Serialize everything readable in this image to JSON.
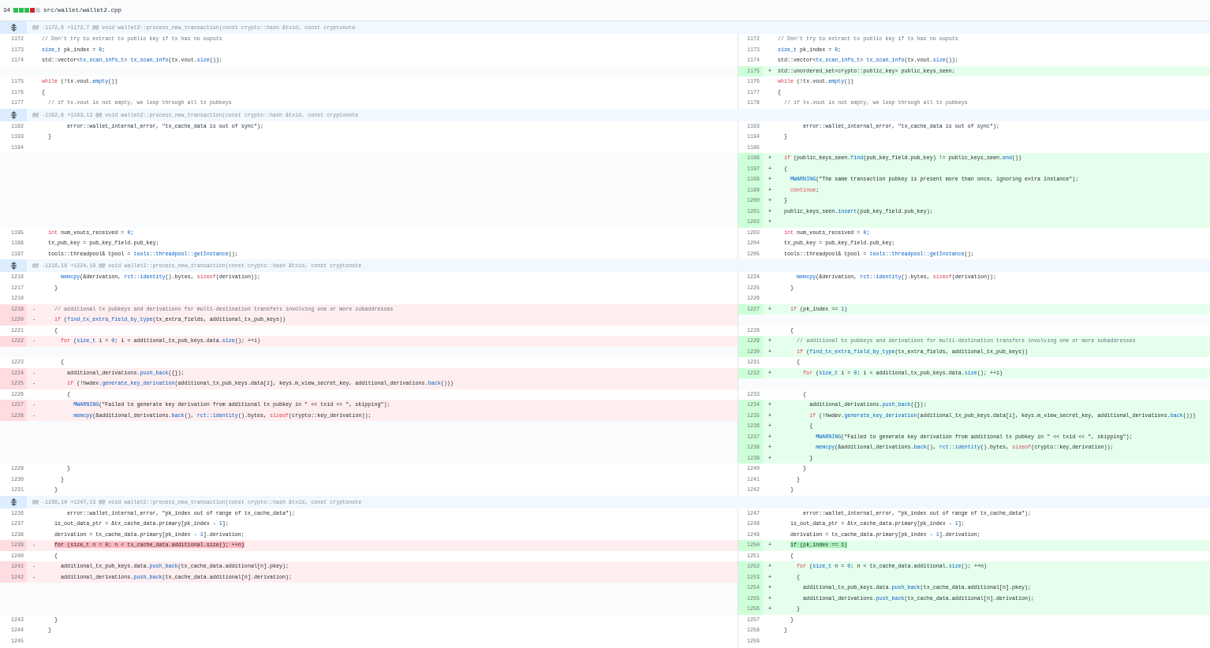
{
  "file_header": {
    "count": "34",
    "diffstat": [
      {
        "kind": "add"
      },
      {
        "kind": "add"
      },
      {
        "kind": "add"
      },
      {
        "kind": "del"
      },
      {
        "kind": "neutral"
      }
    ],
    "path": "src/wallet/wallet2.cpp"
  },
  "rows": [
    {
      "kind": "hunk",
      "text": "@@ -1172,6 +1172,7 @@ void wallet2::process_new_transaction(const crypto::hash &txid, const cryptonote"
    },
    {
      "kind": "line",
      "left": {
        "num": "1172",
        "kind": "context",
        "code": [
          {
            "text": "// Don't try to extract tx public key if tx has no ouputs",
            "kind": "comment"
          }
        ]
      },
      "right": {
        "num": "1172",
        "kind": "context",
        "code": [
          {
            "text": "// Don't try to extract tx public key if tx has no ouputs",
            "kind": "comment"
          }
        ]
      }
    },
    {
      "kind": "line",
      "left": {
        "num": "1173",
        "kind": "context",
        "code": [
          {
            "text": "size_t",
            "kind": "name"
          },
          {
            "text": " pk_index = "
          },
          {
            "text": "0",
            "kind": "name"
          },
          {
            "text": ";"
          }
        ]
      },
      "right": {
        "num": "1173",
        "kind": "context",
        "code": [
          {
            "text": "size_t",
            "kind": "name"
          },
          {
            "text": " pk_index = "
          },
          {
            "text": "0",
            "kind": "name"
          },
          {
            "text": ";"
          }
        ]
      }
    },
    {
      "kind": "line",
      "left": {
        "num": "1174",
        "kind": "context",
        "code": [
          {
            "text": "std::vector<"
          },
          {
            "text": "tx_scan_info_t",
            "kind": "name"
          },
          {
            "text": "> "
          },
          {
            "text": "tx_scan_info",
            "kind": "name"
          },
          {
            "text": "(tx.vout."
          },
          {
            "text": "size",
            "kind": "name"
          },
          {
            "text": "());"
          }
        ]
      },
      "right": {
        "num": "1174",
        "kind": "context",
        "code": [
          {
            "text": "std::vector<"
          },
          {
            "text": "tx_scan_info_t",
            "kind": "name"
          },
          {
            "text": "> "
          },
          {
            "text": "tx_scan_info",
            "kind": "name"
          },
          {
            "text": "(tx.vout."
          },
          {
            "text": "size",
            "kind": "name"
          },
          {
            "text": "());"
          }
        ]
      }
    },
    {
      "kind": "line",
      "left": null,
      "right": {
        "num": "1175",
        "kind": "add",
        "sign": "+",
        "highlighted": false,
        "code": [
          {
            "text": "std::unordered_set<crypto::public_key> public_keys_seen;"
          }
        ]
      }
    },
    {
      "kind": "line",
      "left": {
        "num": "1175",
        "kind": "context",
        "code": [
          {
            "text": "while",
            "kind": "keyword"
          },
          {
            "text": " (!tx.vout."
          },
          {
            "text": "empty",
            "kind": "name"
          },
          {
            "text": "())"
          }
        ]
      },
      "right": {
        "num": "1176",
        "kind": "context",
        "code": [
          {
            "text": "while",
            "kind": "keyword"
          },
          {
            "text": " (!tx.vout."
          },
          {
            "text": "empty",
            "kind": "name"
          },
          {
            "text": "())"
          }
        ]
      }
    },
    {
      "kind": "line",
      "left": {
        "num": "1176",
        "kind": "context",
        "code": [
          {
            "text": "{"
          }
        ]
      },
      "right": {
        "num": "1177",
        "kind": "context",
        "code": [
          {
            "text": "{"
          }
        ]
      }
    },
    {
      "kind": "line",
      "left": {
        "num": "1177",
        "kind": "context",
        "code": [
          {
            "text": "  // if tx.vout is not empty, we loop through all tx pubkeys",
            "kind": "comment"
          }
        ]
      },
      "right": {
        "num": "1178",
        "kind": "context",
        "code": [
          {
            "text": "  // if tx.vout is not empty, we loop through all tx pubkeys",
            "kind": "comment"
          }
        ]
      }
    },
    {
      "kind": "hunk",
      "text": "@@ -1192,6 +1193,13 @@ void wallet2::process_new_transaction(const crypto::hash &txid, const cryptonote"
    },
    {
      "kind": "line",
      "left": {
        "num": "1192",
        "kind": "context",
        "code": [
          {
            "text": "        error::wallet_internal_error, \"tx_cache_data is out of sync\");"
          }
        ]
      },
      "right": {
        "num": "1193",
        "kind": "context",
        "code": [
          {
            "text": "        error::wallet_internal_error, \"tx_cache_data is out of sync\");"
          }
        ]
      }
    },
    {
      "kind": "line",
      "left": {
        "num": "1193",
        "kind": "context",
        "code": [
          {
            "text": "  }"
          }
        ]
      },
      "right": {
        "num": "1194",
        "kind": "context",
        "code": [
          {
            "text": "  }"
          }
        ]
      }
    },
    {
      "kind": "line",
      "left": {
        "num": "1194",
        "kind": "context"
      },
      "right": {
        "num": "1195",
        "kind": "context"
      }
    },
    {
      "kind": "line",
      "left": null,
      "right": {
        "num": "1196",
        "kind": "add",
        "sign": "+",
        "highlighted": false,
        "code": [
          {
            "text": "  if",
            "kind": "keyword"
          },
          {
            "text": " (public_keys_seen."
          },
          {
            "text": "find",
            "kind": "name"
          },
          {
            "text": "(pub_key_field.pub_key) != public_keys_seen."
          },
          {
            "text": "end",
            "kind": "name"
          },
          {
            "text": "())"
          }
        ]
      }
    },
    {
      "kind": "line",
      "left": null,
      "right": {
        "num": "1197",
        "kind": "add",
        "sign": "+",
        "highlighted": false,
        "code": [
          {
            "text": "  {"
          }
        ]
      }
    },
    {
      "kind": "line",
      "left": null,
      "right": {
        "num": "1198",
        "kind": "add",
        "sign": "+",
        "highlighted": false,
        "code": [
          {
            "text": "    MWARNING",
            "kind": "name"
          },
          {
            "text": "(\"The same transaction pubkey is present more than once, ignoring extra instance\");"
          }
        ]
      }
    },
    {
      "kind": "line",
      "left": null,
      "right": {
        "num": "1199",
        "kind": "add",
        "sign": "+",
        "highlighted": false,
        "code": [
          {
            "text": "    continue",
            "kind": "keyword"
          },
          {
            "text": ";"
          }
        ]
      }
    },
    {
      "kind": "line",
      "left": null,
      "right": {
        "num": "1200",
        "kind": "add",
        "sign": "+",
        "highlighted": false,
        "code": [
          {
            "text": "  }"
          }
        ]
      }
    },
    {
      "kind": "line",
      "left": null,
      "right": {
        "num": "1201",
        "kind": "add",
        "sign": "+",
        "highlighted": false,
        "code": [
          {
            "text": "  public_keys_seen."
          },
          {
            "text": "insert",
            "kind": "name"
          },
          {
            "text": "(pub_key_field.pub_key);"
          }
        ]
      }
    },
    {
      "kind": "line",
      "left": null,
      "right": {
        "num": "1202",
        "kind": "add",
        "sign": "+"
      }
    },
    {
      "kind": "line",
      "left": {
        "num": "1195",
        "kind": "context",
        "code": [
          {
            "text": "  int",
            "kind": "keyword"
          },
          {
            "text": " num_vouts_received = "
          },
          {
            "text": "0",
            "kind": "name"
          },
          {
            "text": ";"
          }
        ]
      },
      "right": {
        "num": "1203",
        "kind": "context",
        "code": [
          {
            "text": "  int",
            "kind": "keyword"
          },
          {
            "text": " num_vouts_received = "
          },
          {
            "text": "0",
            "kind": "name"
          },
          {
            "text": ";"
          }
        ]
      }
    },
    {
      "kind": "line",
      "left": {
        "num": "1196",
        "kind": "context",
        "code": [
          {
            "text": "  tx_pub_key = pub_key_field.pub_key;"
          }
        ]
      },
      "right": {
        "num": "1204",
        "kind": "context",
        "code": [
          {
            "text": "  tx_pub_key = pub_key_field.pub_key;"
          }
        ]
      }
    },
    {
      "kind": "line",
      "left": {
        "num": "1197",
        "kind": "context",
        "code": [
          {
            "text": "  tools::threadpool& tpool = "
          },
          {
            "text": "tools::threadpool::getInstance",
            "kind": "name"
          },
          {
            "text": "();"
          }
        ]
      },
      "right": {
        "num": "1205",
        "kind": "context",
        "code": [
          {
            "text": "  tools::threadpool& tpool = "
          },
          {
            "text": "tools::threadpool::getInstance",
            "kind": "name"
          },
          {
            "text": "();"
          }
        ]
      }
    },
    {
      "kind": "hunk",
      "text": "@@ -1216,16 +1224,19 @@ void wallet2::process_new_transaction(const crypto::hash &txid, const cryptonote"
    },
    {
      "kind": "line",
      "left": {
        "num": "1216",
        "kind": "context",
        "code": [
          {
            "text": "      memcpy",
            "kind": "name"
          },
          {
            "text": "(&derivation, "
          },
          {
            "text": "rct::identity",
            "kind": "name"
          },
          {
            "text": "().bytes, "
          },
          {
            "text": "sizeof",
            "kind": "keyword"
          },
          {
            "text": "(derivation));"
          }
        ]
      },
      "right": {
        "num": "1224",
        "kind": "context",
        "code": [
          {
            "text": "      memcpy",
            "kind": "name"
          },
          {
            "text": "(&derivation, "
          },
          {
            "text": "rct::identity",
            "kind": "name"
          },
          {
            "text": "().bytes, "
          },
          {
            "text": "sizeof",
            "kind": "keyword"
          },
          {
            "text": "(derivation));"
          }
        ]
      }
    },
    {
      "kind": "line",
      "left": {
        "num": "1217",
        "kind": "context",
        "code": [
          {
            "text": "    }"
          }
        ]
      },
      "right": {
        "num": "1225",
        "kind": "context",
        "code": [
          {
            "text": "    }"
          }
        ]
      }
    },
    {
      "kind": "line",
      "left": {
        "num": "1218",
        "kind": "context"
      },
      "right": {
        "num": "1226",
        "kind": "context"
      }
    },
    {
      "kind": "line",
      "left": {
        "num": "1219",
        "kind": "del",
        "sign": "-",
        "highlighted": false,
        "code": [
          {
            "text": "    // additional tx pubkeys and derivations for multi-destination transfers involving one or more subaddresses",
            "kind": "comment"
          }
        ]
      },
      "right": {
        "num": "1227",
        "kind": "add",
        "sign": "+",
        "highlighted": false,
        "code": [
          {
            "text": "    if",
            "kind": "keyword"
          },
          {
            "text": " (pk_index == "
          },
          {
            "text": "1",
            "kind": "name"
          },
          {
            "text": ")"
          }
        ]
      }
    },
    {
      "kind": "line",
      "left": {
        "num": "1220",
        "kind": "del",
        "sign": "-",
        "highlighted": false,
        "code": [
          {
            "text": "    if",
            "kind": "keyword"
          },
          {
            "text": " ("
          },
          {
            "text": "find_tx_extra_field_by_type",
            "kind": "name"
          },
          {
            "text": "(tx_extra_fields, additional_tx_pub_keys))"
          }
        ]
      },
      "right": null
    },
    {
      "kind": "line",
      "left": {
        "num": "1221",
        "kind": "context",
        "code": [
          {
            "text": "    {"
          }
        ]
      },
      "right": {
        "num": "1228",
        "kind": "context",
        "code": [
          {
            "text": "    {"
          }
        ]
      }
    },
    {
      "kind": "line",
      "left": {
        "num": "1222",
        "kind": "del",
        "sign": "-",
        "highlighted": false,
        "code": [
          {
            "text": "      for",
            "kind": "keyword"
          },
          {
            "text": " ("
          },
          {
            "text": "size_t",
            "kind": "name"
          },
          {
            "text": " i = "
          },
          {
            "text": "0",
            "kind": "name"
          },
          {
            "text": "; i < additional_tx_pub_keys.data."
          },
          {
            "text": "size",
            "kind": "name"
          },
          {
            "text": "(); ++i)"
          }
        ]
      },
      "right": {
        "num": "1229",
        "kind": "add",
        "sign": "+",
        "highlighted": false,
        "code": [
          {
            "text": "      // additional tx pubkeys and derivations for multi-destination transfers involving one or more subaddresses",
            "kind": "comment"
          }
        ]
      }
    },
    {
      "kind": "line",
      "left": null,
      "right": {
        "num": "1230",
        "kind": "add",
        "sign": "+",
        "highlighted": false,
        "code": [
          {
            "text": "      if",
            "kind": "keyword"
          },
          {
            "text": " ("
          },
          {
            "text": "find_tx_extra_field_by_type",
            "kind": "name"
          },
          {
            "text": "(tx_extra_fields, additional_tx_pub_keys))"
          }
        ]
      }
    },
    {
      "kind": "line",
      "left": {
        "num": "1223",
        "kind": "context",
        "code": [
          {
            "text": "      {"
          }
        ]
      },
      "right": {
        "num": "1231",
        "kind": "context",
        "code": [
          {
            "text": "      {"
          }
        ]
      }
    },
    {
      "kind": "line",
      "left": {
        "num": "1224",
        "kind": "del",
        "sign": "-",
        "highlighted": false,
        "code": [
          {
            "text": "        additional_derivations."
          },
          {
            "text": "push_back",
            "kind": "name"
          },
          {
            "text": "({});"
          }
        ]
      },
      "right": {
        "num": "1232",
        "kind": "add",
        "sign": "+",
        "highlighted": false,
        "code": [
          {
            "text": "        for",
            "kind": "keyword"
          },
          {
            "text": " ("
          },
          {
            "text": "size_t",
            "kind": "name"
          },
          {
            "text": " i = "
          },
          {
            "text": "0",
            "kind": "name"
          },
          {
            "text": "; i < additional_tx_pub_keys.data."
          },
          {
            "text": "size",
            "kind": "name"
          },
          {
            "text": "(); ++i)"
          }
        ]
      }
    },
    {
      "kind": "line",
      "left": {
        "num": "1225",
        "kind": "del",
        "sign": "-",
        "highlighted": false,
        "code": [
          {
            "text": "        if",
            "kind": "keyword"
          },
          {
            "text": " (!hwdev."
          },
          {
            "text": "generate_key_derivation",
            "kind": "name"
          },
          {
            "text": "(additional_tx_pub_keys.data[i], keys.m_view_secret_key, additional_derivations."
          },
          {
            "text": "back",
            "kind": "name"
          },
          {
            "text": "()))"
          }
        ]
      },
      "right": null
    },
    {
      "kind": "line",
      "left": {
        "num": "1226",
        "kind": "context",
        "code": [
          {
            "text": "        {"
          }
        ]
      },
      "right": {
        "num": "1233",
        "kind": "context",
        "code": [
          {
            "text": "        {"
          }
        ]
      }
    },
    {
      "kind": "line",
      "left": {
        "num": "1227",
        "kind": "del",
        "sign": "-",
        "highlighted": false,
        "code": [
          {
            "text": "          MWARNING",
            "kind": "name"
          },
          {
            "text": "(\"Failed to generate key derivation from additional tx pubkey in \" << txid << \", skipping\");"
          }
        ]
      },
      "right": {
        "num": "1234",
        "kind": "add",
        "sign": "+",
        "highlighted": false,
        "code": [
          {
            "text": "          additional_derivations."
          },
          {
            "text": "push_back",
            "kind": "name"
          },
          {
            "text": "({});"
          }
        ]
      }
    },
    {
      "kind": "line",
      "left": {
        "num": "1228",
        "kind": "del",
        "sign": "-",
        "highlighted": false,
        "code": [
          {
            "text": "          memcpy",
            "kind": "name"
          },
          {
            "text": "(&additional_derivations."
          },
          {
            "text": "back",
            "kind": "name"
          },
          {
            "text": "(), "
          },
          {
            "text": "rct::identity",
            "kind": "name"
          },
          {
            "text": "().bytes, "
          },
          {
            "text": "sizeof",
            "kind": "keyword"
          },
          {
            "text": "(crypto::key_derivation));"
          }
        ]
      },
      "right": {
        "num": "1235",
        "kind": "add",
        "sign": "+",
        "highlighted": false,
        "code": [
          {
            "text": "          if",
            "kind": "keyword"
          },
          {
            "text": " (!hwdev."
          },
          {
            "text": "generate_key_derivation",
            "kind": "name"
          },
          {
            "text": "(additional_tx_pub_keys.data[i], keys.m_view_secret_key, additional_derivations."
          },
          {
            "text": "back",
            "kind": "name"
          },
          {
            "text": "()))"
          }
        ]
      }
    },
    {
      "kind": "line",
      "left": null,
      "right": {
        "num": "1236",
        "kind": "add",
        "sign": "+",
        "highlighted": false,
        "code": [
          {
            "text": "          {"
          }
        ]
      }
    },
    {
      "kind": "line",
      "left": null,
      "right": {
        "num": "1237",
        "kind": "add",
        "sign": "+",
        "highlighted": false,
        "code": [
          {
            "text": "            MWARNING",
            "kind": "name"
          },
          {
            "text": "(\"Failed to generate key derivation from additional tx pubkey in \" << txid << \", skipping\");"
          }
        ]
      }
    },
    {
      "kind": "line",
      "left": null,
      "right": {
        "num": "1238",
        "kind": "add",
        "sign": "+",
        "highlighted": false,
        "code": [
          {
            "text": "            memcpy",
            "kind": "name"
          },
          {
            "text": "(&additional_derivations."
          },
          {
            "text": "back",
            "kind": "name"
          },
          {
            "text": "(), "
          },
          {
            "text": "rct::identity",
            "kind": "name"
          },
          {
            "text": "().bytes, "
          },
          {
            "text": "sizeof",
            "kind": "keyword"
          },
          {
            "text": "(crypto::key_derivation));"
          }
        ]
      }
    },
    {
      "kind": "line",
      "left": null,
      "right": {
        "num": "1239",
        "kind": "add",
        "sign": "+",
        "highlighted": false,
        "code": [
          {
            "text": "          }"
          }
        ]
      }
    },
    {
      "kind": "line",
      "left": {
        "num": "1229",
        "kind": "context",
        "code": [
          {
            "text": "        }"
          }
        ]
      },
      "right": {
        "num": "1240",
        "kind": "context",
        "code": [
          {
            "text": "        }"
          }
        ]
      }
    },
    {
      "kind": "line",
      "left": {
        "num": "1230",
        "kind": "context",
        "code": [
          {
            "text": "      }"
          }
        ]
      },
      "right": {
        "num": "1241",
        "kind": "context",
        "code": [
          {
            "text": "      }"
          }
        ]
      }
    },
    {
      "kind": "line",
      "left": {
        "num": "1231",
        "kind": "context",
        "code": [
          {
            "text": "    }"
          }
        ]
      },
      "right": {
        "num": "1242",
        "kind": "context",
        "code": [
          {
            "text": "    }"
          }
        ]
      }
    },
    {
      "kind": "hunk",
      "text": "@@ -1236,10 +1247,13 @@ void wallet2::process_new_transaction(const crypto::hash &txid, const cryptonote"
    },
    {
      "kind": "line",
      "left": {
        "num": "1236",
        "kind": "context",
        "code": [
          {
            "text": "        error::wallet_internal_error, \"pk_index out of range of tx_cache_data\");"
          }
        ]
      },
      "right": {
        "num": "1247",
        "kind": "context",
        "code": [
          {
            "text": "        error::wallet_internal_error, \"pk_index out of range of tx_cache_data\");"
          }
        ]
      }
    },
    {
      "kind": "line",
      "left": {
        "num": "1237",
        "kind": "context",
        "code": [
          {
            "text": "    is_out_data_ptr = &tx_cache_data.primary[pk_index - "
          },
          {
            "text": "1",
            "kind": "name"
          },
          {
            "text": "];"
          }
        ]
      },
      "right": {
        "num": "1248",
        "kind": "context",
        "code": [
          {
            "text": "    is_out_data_ptr = &tx_cache_data.primary[pk_index - "
          },
          {
            "text": "1",
            "kind": "name"
          },
          {
            "text": "];"
          }
        ]
      }
    },
    {
      "kind": "line",
      "left": {
        "num": "1238",
        "kind": "context",
        "code": [
          {
            "text": "    derivation = tx_cache_data.primary[pk_index - "
          },
          {
            "text": "1",
            "kind": "name"
          },
          {
            "text": "].derivation;"
          }
        ]
      },
      "right": {
        "num": "1249",
        "kind": "context",
        "code": [
          {
            "text": "    derivation = tx_cache_data.primary[pk_index - "
          },
          {
            "text": "1",
            "kind": "name"
          },
          {
            "text": "].derivation;"
          }
        ]
      }
    },
    {
      "kind": "line",
      "left": {
        "num": "1239",
        "kind": "del",
        "sign": "-",
        "highlighted": true,
        "code": [
          {
            "text": "    for (size_t n = 0; n < tx_cache_data.additional.size(); ++n)"
          }
        ]
      },
      "right": {
        "num": "1250",
        "kind": "add",
        "sign": "+",
        "highlighted": true,
        "code": [
          {
            "text": "    if (pk_index == 1)"
          }
        ]
      }
    },
    {
      "kind": "line",
      "left": {
        "num": "1240",
        "kind": "context",
        "code": [
          {
            "text": "    {"
          }
        ]
      },
      "right": {
        "num": "1251",
        "kind": "context",
        "code": [
          {
            "text": "    {"
          }
        ]
      }
    },
    {
      "kind": "line",
      "left": {
        "num": "1241",
        "kind": "del",
        "sign": "-",
        "highlighted": false,
        "code": [
          {
            "text": "      additional_tx_pub_keys.data."
          },
          {
            "text": "push_back",
            "kind": "name"
          },
          {
            "text": "(tx_cache_data.additional[n].pkey);"
          }
        ]
      },
      "right": {
        "num": "1252",
        "kind": "add",
        "sign": "+",
        "highlighted": false,
        "code": [
          {
            "text": "      for",
            "kind": "keyword"
          },
          {
            "text": " ("
          },
          {
            "text": "size_t",
            "kind": "name"
          },
          {
            "text": " n = "
          },
          {
            "text": "0",
            "kind": "name"
          },
          {
            "text": "; n < tx_cache_data.additional."
          },
          {
            "text": "size",
            "kind": "name"
          },
          {
            "text": "(); ++n)"
          }
        ]
      }
    },
    {
      "kind": "line",
      "left": {
        "num": "1242",
        "kind": "del",
        "sign": "-",
        "highlighted": false,
        "code": [
          {
            "text": "      additional_derivations."
          },
          {
            "text": "push_back",
            "kind": "name"
          },
          {
            "text": "(tx_cache_data.additional[n].derivation);"
          }
        ]
      },
      "right": {
        "num": "1253",
        "kind": "add",
        "sign": "+",
        "highlighted": false,
        "code": [
          {
            "text": "      {"
          }
        ]
      }
    },
    {
      "kind": "line",
      "left": null,
      "right": {
        "num": "1254",
        "kind": "add",
        "sign": "+",
        "highlighted": false,
        "code": [
          {
            "text": "        additional_tx_pub_keys.data."
          },
          {
            "text": "push_back",
            "kind": "name"
          },
          {
            "text": "(tx_cache_data.additional[n].pkey);"
          }
        ]
      }
    },
    {
      "kind": "line",
      "left": null,
      "right": {
        "num": "1255",
        "kind": "add",
        "sign": "+",
        "highlighted": false,
        "code": [
          {
            "text": "        additional_derivations."
          },
          {
            "text": "push_back",
            "kind": "name"
          },
          {
            "text": "(tx_cache_data.additional[n].derivation);"
          }
        ]
      }
    },
    {
      "kind": "line",
      "left": null,
      "right": {
        "num": "1256",
        "kind": "add",
        "sign": "+",
        "highlighted": false,
        "code": [
          {
            "text": "      }"
          }
        ]
      }
    },
    {
      "kind": "line",
      "left": {
        "num": "1243",
        "kind": "context",
        "code": [
          {
            "text": "    }"
          }
        ]
      },
      "right": {
        "num": "1257",
        "kind": "context",
        "code": [
          {
            "text": "    }"
          }
        ]
      }
    },
    {
      "kind": "line",
      "left": {
        "num": "1244",
        "kind": "context",
        "code": [
          {
            "text": "  }"
          }
        ]
      },
      "right": {
        "num": "1258",
        "kind": "context",
        "code": [
          {
            "text": "  }"
          }
        ]
      }
    },
    {
      "kind": "line",
      "left": {
        "num": "1245",
        "kind": "context"
      },
      "right": {
        "num": "1259",
        "kind": "context"
      }
    }
  ]
}
